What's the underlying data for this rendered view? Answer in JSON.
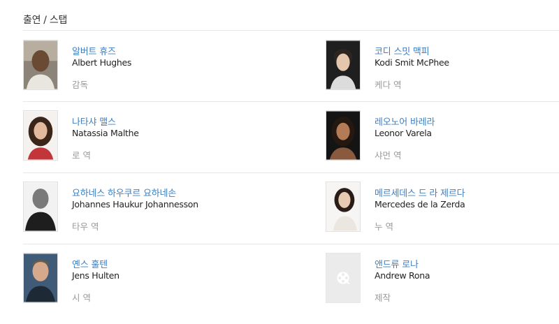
{
  "section": {
    "title": "출연 / 스탭"
  },
  "cast": [
    {
      "name_ko": "알버트 휴즈",
      "name_en": "Albert Hughes",
      "role": "감독"
    },
    {
      "name_ko": "코디 스밋 맥피",
      "name_en": "Kodi Smit McPhee",
      "role": "케다 역"
    },
    {
      "name_ko": "나타샤 맬스",
      "name_en": "Natassia Malthe",
      "role": "로 역"
    },
    {
      "name_ko": "레오노어 바레라",
      "name_en": "Leonor Varela",
      "role": "샤먼 역"
    },
    {
      "name_ko": "요하네스 하우쿠르 요하네손",
      "name_en": "Johannes Haukur Johannesson",
      "role": "타우 역"
    },
    {
      "name_ko": "메르세데스 드 라 제르다",
      "name_en": "Mercedes de la Zerda",
      "role": "누 역"
    },
    {
      "name_ko": "옌스 훌텐",
      "name_en": "Jens Hulten",
      "role": "시 역"
    },
    {
      "name_ko": "앤드류 로나",
      "name_en": "Andrew Rona",
      "role": "제작"
    }
  ],
  "colors": {
    "link": "#3d7fc2",
    "text": "#222222",
    "muted": "#9a9a9a",
    "divider": "#e6e6e6"
  }
}
